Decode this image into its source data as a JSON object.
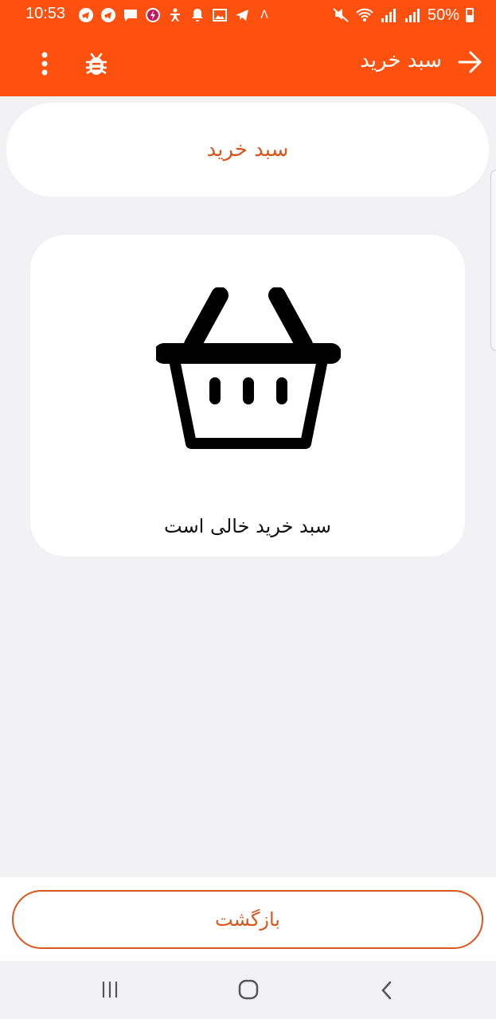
{
  "status_bar": {
    "time": "10:53",
    "signal_extra": "Λ",
    "battery": "50%",
    "left_icons": [
      "telegram-icon",
      "telegram-icon",
      "message-icon",
      "charge-app-icon",
      "accessibility-icon",
      "bell-icon",
      "image-icon",
      "telegram-send-icon",
      "chevron-up-icon"
    ],
    "right_icons": [
      "mute-icon",
      "wifi-icon",
      "signal-icon",
      "signal-icon",
      "battery-icon"
    ]
  },
  "app_bar": {
    "title": "سبد خرید",
    "color": "#fe5110",
    "icons": [
      "back-arrow-icon",
      "bug-icon",
      "more-vert-icon"
    ]
  },
  "header_card": {
    "title": "سبد خرید",
    "color": "#d9571d"
  },
  "empty_state": {
    "message": "سبد خرید خالی است",
    "icon": "basket-icon"
  },
  "footer": {
    "back_label": "بازگشت",
    "accent": "#d9571d"
  },
  "nav_bar": {
    "icons": [
      "recents-icon",
      "home-icon",
      "back-icon"
    ]
  }
}
